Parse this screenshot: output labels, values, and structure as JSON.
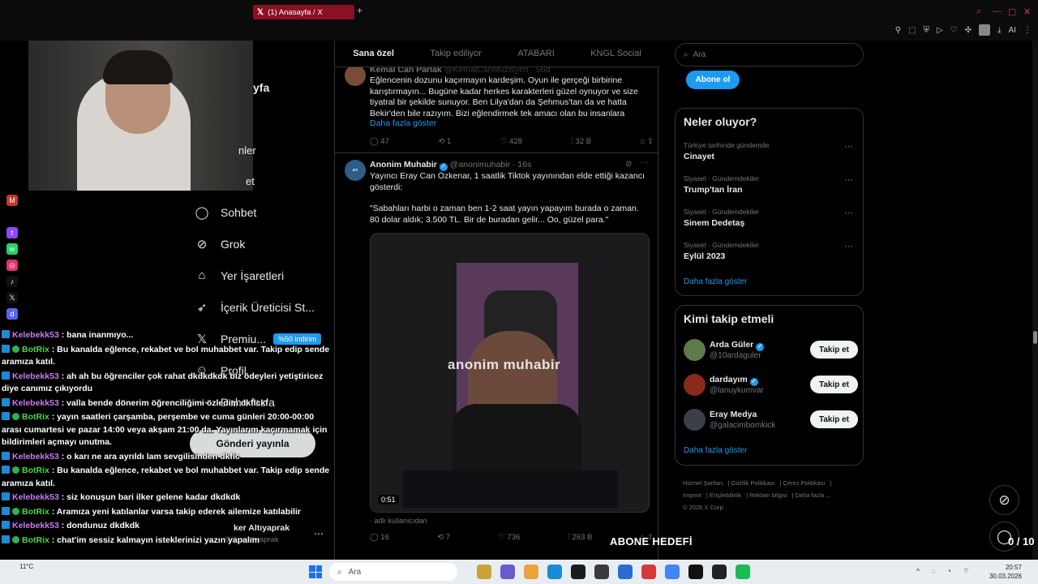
{
  "browser": {
    "tab_title": "(1) Anasayfa / X",
    "new_tab": "+"
  },
  "sidebar": {
    "partial_title": "yfa",
    "partial_item1": "nler",
    "partial_item2": "et",
    "items": [
      {
        "label": "Sohbet",
        "icon": "chat-icon"
      },
      {
        "label": "Grok",
        "icon": "grok-icon"
      },
      {
        "label": "Yer İşaretleri",
        "icon": "bookmark-icon"
      },
      {
        "label": "İçerik Üreticisi St...",
        "icon": "rocket-icon"
      },
      {
        "label": "Premiu...",
        "icon": "x-icon"
      },
      {
        "label": "Profil",
        "icon": "profile-icon"
      },
      {
        "label": "Daha fazla",
        "icon": "more-icon"
      }
    ],
    "premium_badge": "%50 indirim",
    "post_button": "Gönderi yayınla",
    "account_name": "ker Altıyaprak",
    "account_handle": "@ilkeraltiyaprak"
  },
  "chat": [
    {
      "user": "Kelebekk53",
      "text": " : bana inanmıyo...",
      "type": "kele"
    },
    {
      "user": "BotRix",
      "text": " : Bu kanalda eğlence, rekabet ve bol muhabbet var. Takip edip sende aramıza katıl.",
      "type": "bot"
    },
    {
      "user": "Kelebekk53",
      "text": " : ah ah bu öğrenciler çok rahat dkdkdkdk biz ödeyleri yetiştiricez diye canımız çıkıyordu",
      "type": "kele"
    },
    {
      "user": "Kelebekk53",
      "text": " : valla bende dönerim öğrenciliğimi özledim dkflckf",
      "type": "kele"
    },
    {
      "user": "BotRix",
      "text": " : yayın saatleri çarşamba, perşembe ve cuma günleri 20:00-00:00 arası cumartesi ve pazar 14:00 veya akşam 21:00 da. Yayınlarım kaçırmamak için bildirimleri açmayı unutma.",
      "type": "bot"
    },
    {
      "user": "Kelebekk53",
      "text": " : o karı ne ara ayrıldı lam sevgilisinden dkflc",
      "type": "kele"
    },
    {
      "user": "BotRix",
      "text": " : Bu kanalda eğlence, rekabet ve bol muhabbet var. Takip edip sende aramıza katıl.",
      "type": "bot"
    },
    {
      "user": "Kelebekk53",
      "text": " : siz konuşun bari ilker gelene kadar dkdkdk",
      "type": "kele"
    },
    {
      "user": "BotRix",
      "text": " : Aramıza yeni katılanlar varsa takip ederek ailemize katılabilir",
      "type": "bot"
    },
    {
      "user": "Kelebekk53",
      "text": " : dondunuz dkdkdk",
      "type": "kele"
    },
    {
      "user": "BotRix",
      "text": " : chat'im sessiz kalmayın isteklerinizi yazın yapalım",
      "type": "bot"
    }
  ],
  "timeline": {
    "tabs": [
      "Sana özel",
      "Takip ediliyor",
      "ATABARI",
      "KNGL Social"
    ],
    "tweet1": {
      "author": "Kemal Can Parlak",
      "handle": "@KemalCanMuzisyen · 56d",
      "text": "Eğlencenin dozunu kaçırmayın kardeşim. Oyun ile gerçeği birbirine karıştırmayın... Bugüne kadar herkes karakterleri güzel oynuyor ve size tiyatral bir şekilde sunuyor. Ben Lilya'dan da Şehmus'tan da ve hatta Bekir'den bile razıyım. Bizi eğlendirmek tek amacı olan bu insanlara",
      "show_more": "Daha fazla göster",
      "replies": "47",
      "reposts": "1",
      "likes": "428",
      "views": "32 B"
    },
    "tweet2": {
      "author": "Anonim Muhabir",
      "handle": "@anonimuhabir · 16s",
      "text": "Yayıncı Eray Can Özkenar, 1 saatlik Tiktok yayınından elde ettiği kazancı gösterdi:",
      "quote": "\"Sabahları harbi o zaman ben 1-2 saat yayın yapayım burada o zaman. 80 dolar aldık; 3.500 TL. Bir de buradan gelir... Oo, güzel para.\"",
      "video_watermark": "anonim muhabir",
      "video_duration": "0:51",
      "source": "· adlı kullanıcıdan",
      "replies": "16",
      "reposts": "7",
      "likes": "736",
      "views": "263 B"
    }
  },
  "right": {
    "search_placeholder": "Ara",
    "subscribe": "Abone ol",
    "trends_title": "Neler oluyor?",
    "trends": [
      {
        "meta": "Türkiye tarihinde gündemde",
        "name": "Cinayet"
      },
      {
        "meta": "Siyaset · Gündemdekiler",
        "name": "Trump'tan İran"
      },
      {
        "meta": "Siyaset · Gündemdekiler",
        "name": "Sinem Dedetaş"
      },
      {
        "meta": "Siyaset · Gündemdekiler",
        "name": "Eylül 2023"
      }
    ],
    "show_more": "Daha fazla göster",
    "who_title": "Kimi takip etmeli",
    "who": [
      {
        "name": "Arda Güler",
        "handle": "@10ardaguler",
        "btn": "Takip et"
      },
      {
        "name": "dardayım",
        "handle": "@lanuykumvar",
        "btn": "Takip et"
      },
      {
        "name": "Eray Medya",
        "handle": "@galacimbomkick",
        "btn": "Takip et"
      }
    ],
    "who_more": "Daha fazla göster",
    "footer": [
      "Hizmet Şartları",
      "Gizlilik Politikası",
      "Çerez Politikası",
      "Imprint",
      "Erişilebilirlik",
      "Reklam bilgisi",
      "Daha fazla ...",
      "© 2026 X Corp."
    ]
  },
  "overlay": {
    "abone_label": "ABONE HEDEFİ",
    "abone_count": "0 / 10"
  },
  "taskbar": {
    "search": "Ara",
    "time": "20:57",
    "date": "30.03.2026",
    "weather": "11°C"
  }
}
